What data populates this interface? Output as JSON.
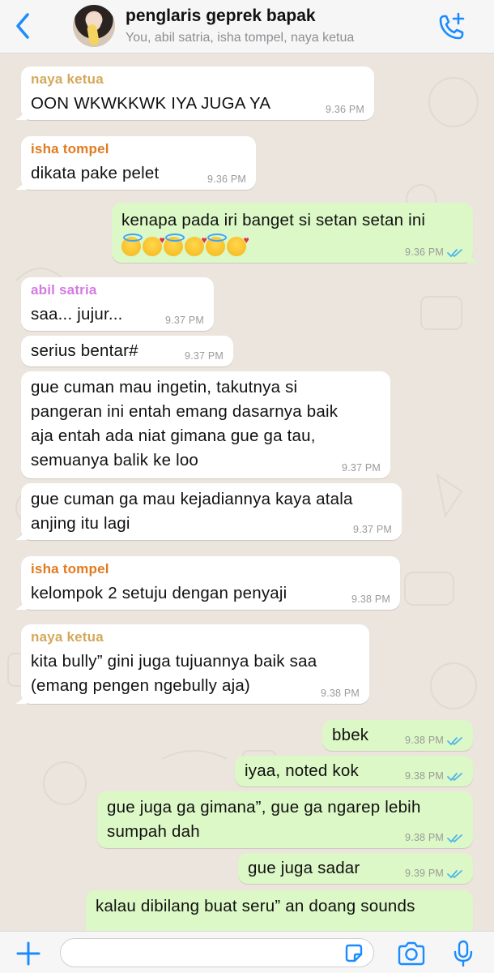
{
  "header": {
    "title": "penglaris geprek bapak",
    "subtitle": "You, abil satria, isha tompel, naya ketua",
    "back_icon": "chevron-left-icon",
    "call_icon": "add-call-icon",
    "accent_color": "#1a8cff"
  },
  "messages": [
    {
      "direction": "in",
      "sender": "naya ketua",
      "sender_color": "#d4a85a",
      "lines": [
        "OON WKWKKWK IYA JUGA YA"
      ],
      "time": "9.36 PM"
    },
    {
      "direction": "in",
      "sender": "isha tompel",
      "sender_color": "#e07b1e",
      "lines": [
        "dikata pake pelet"
      ],
      "time": "9.36 PM"
    },
    {
      "direction": "out",
      "lines": [
        "kenapa pada iri banget si setan setan ini"
      ],
      "emoji_names": [
        "smiling-face-with-halo",
        "smiling-face-with-hearts",
        "smiling-face-with-halo",
        "smiling-face-with-hearts",
        "smiling-face-with-halo",
        "smiling-face-with-hearts"
      ],
      "time": "9.36 PM",
      "read": true
    },
    {
      "direction": "in",
      "sender": "abil satria",
      "sender_color": "#d27ae0",
      "lines": [
        "saa... jujur..."
      ],
      "time": "9.37 PM"
    },
    {
      "direction": "in",
      "lines": [
        "serius bentar#"
      ],
      "time": "9.37 PM"
    },
    {
      "direction": "in",
      "lines": [
        "gue cuman mau ingetin, takutnya si",
        "pangeran ini entah emang dasarnya baik",
        "aja entah ada niat gimana gue ga tau,",
        "semuanya balik ke loo"
      ],
      "time": "9.37 PM"
    },
    {
      "direction": "in",
      "lines": [
        "gue cuman ga mau kejadiannya kaya atala",
        "anjing itu lagi"
      ],
      "time": "9.37 PM"
    },
    {
      "direction": "in",
      "sender": "isha tompel",
      "sender_color": "#e07b1e",
      "lines": [
        "kelompok 2 setuju dengan penyaji"
      ],
      "time": "9.38 PM"
    },
    {
      "direction": "in",
      "sender": "naya ketua",
      "sender_color": "#d4a85a",
      "lines": [
        "kita bully” gini juga tujuannya baik saa",
        "(emang pengen ngebully aja)"
      ],
      "time": "9.38 PM"
    },
    {
      "direction": "out",
      "lines": [
        "bbek"
      ],
      "time": "9.38 PM",
      "read": true
    },
    {
      "direction": "out",
      "lines": [
        "iyaa, noted kok"
      ],
      "time": "9.38 PM",
      "read": true
    },
    {
      "direction": "out",
      "lines": [
        "gue juga ga gimana”, gue ga ngarep lebih",
        "sumpah dah"
      ],
      "time": "9.38 PM",
      "read": true
    },
    {
      "direction": "out",
      "lines": [
        "gue juga sadar"
      ],
      "time": "9.39 PM",
      "read": true
    },
    {
      "direction": "out",
      "lines": [
        "kalau dibilang buat seru” an doang sounds"
      ],
      "time": "",
      "read": false
    }
  ],
  "composer": {
    "placeholder": "",
    "plus_icon": "plus-icon",
    "sticker_icon": "sticker-icon",
    "camera_icon": "camera-icon",
    "mic_icon": "microphone-icon"
  },
  "colors": {
    "background": "#ece5dd",
    "incoming_bubble": "#ffffff",
    "outgoing_bubble": "#dcf8c6",
    "read_ticks": "#4fb6ec"
  }
}
